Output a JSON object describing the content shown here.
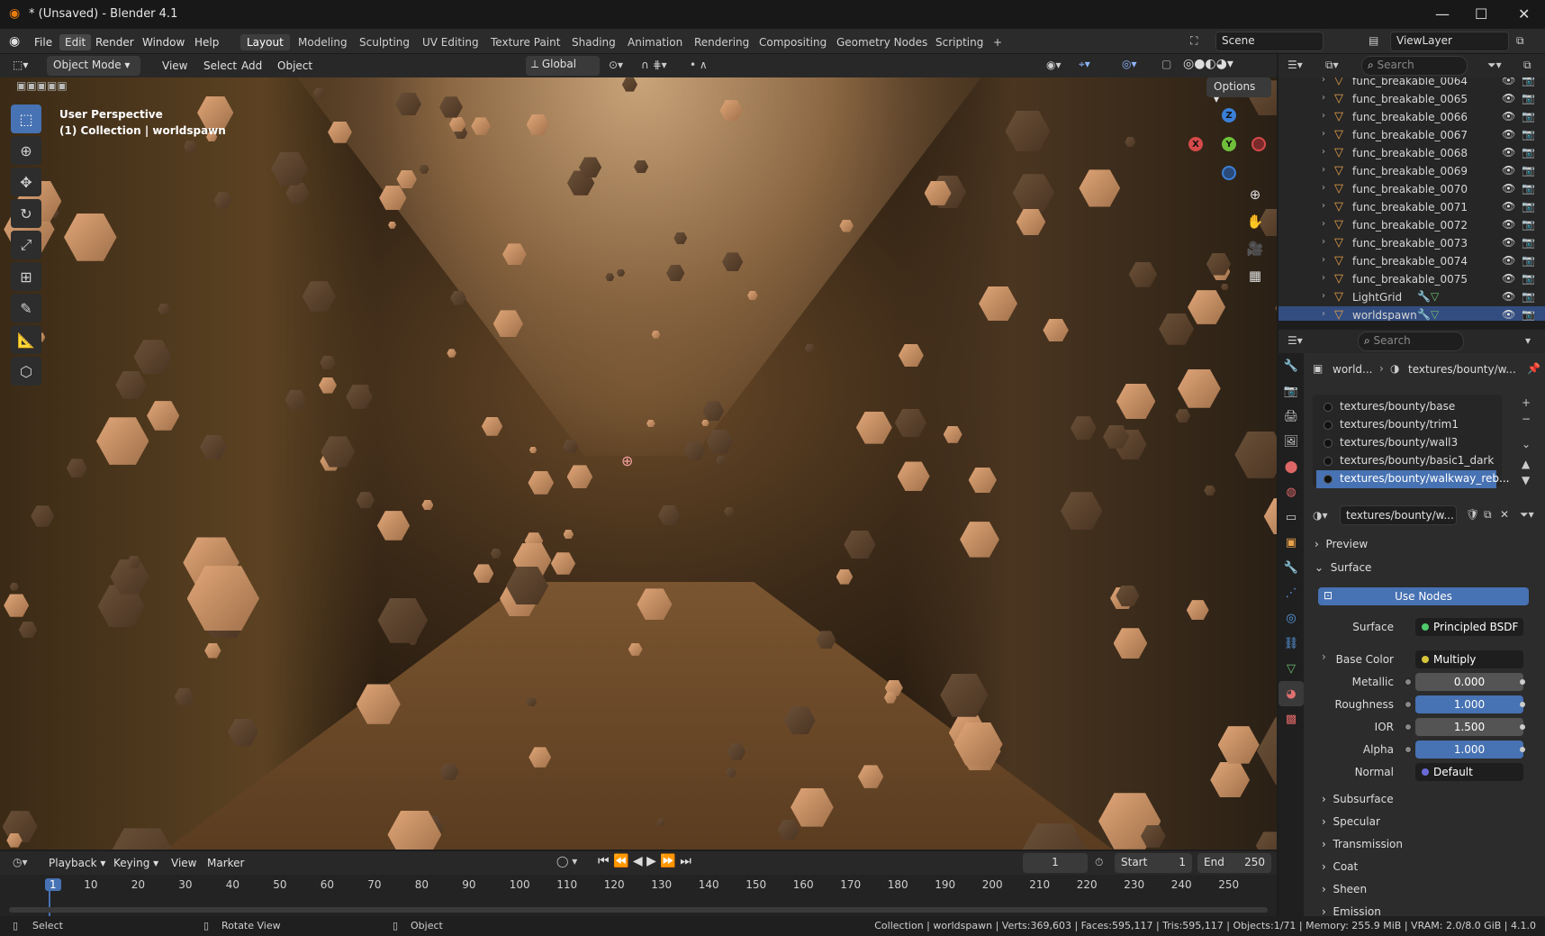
{
  "title_bar": {
    "title": "* (Unsaved) - Blender 4.1",
    "minimize": "—",
    "maximize": "☐",
    "close": "✕"
  },
  "menu": {
    "items": [
      "File",
      "Edit",
      "Render",
      "Window",
      "Help"
    ],
    "highlighted": "Edit"
  },
  "workspaces": {
    "tabs": [
      "Layout",
      "Modeling",
      "Sculpting",
      "UV Editing",
      "Texture Paint",
      "Shading",
      "Animation",
      "Rendering",
      "Compositing",
      "Geometry Nodes",
      "Scripting"
    ],
    "active": "Layout",
    "add": "+"
  },
  "scene": {
    "label": "Scene",
    "view_layer": "ViewLayer"
  },
  "viewport_header": {
    "mode": "Object Mode",
    "menus": [
      "View",
      "Select",
      "Add",
      "Object"
    ],
    "transform": "Global",
    "options": "Options"
  },
  "viewport": {
    "perspective": "User Perspective",
    "collection": "(1) Collection | worldspawn"
  },
  "gizmo": {
    "x": "X",
    "y": "Y",
    "z": "Z"
  },
  "outliner": {
    "search_placeholder": "Search",
    "items": [
      {
        "name": "func_breakable_0064"
      },
      {
        "name": "func_breakable_0065"
      },
      {
        "name": "func_breakable_0066"
      },
      {
        "name": "func_breakable_0067"
      },
      {
        "name": "func_breakable_0068"
      },
      {
        "name": "func_breakable_0069"
      },
      {
        "name": "func_breakable_0070"
      },
      {
        "name": "func_breakable_0071"
      },
      {
        "name": "func_breakable_0072"
      },
      {
        "name": "func_breakable_0073"
      },
      {
        "name": "func_breakable_0074"
      },
      {
        "name": "func_breakable_0075"
      },
      {
        "name": "LightGrid"
      },
      {
        "name": "worldspawn"
      }
    ],
    "selected": "worldspawn"
  },
  "properties": {
    "search_placeholder": "Search",
    "breadcrumb_object": "world...",
    "breadcrumb_material": "textures/bounty/w...",
    "material_slots": [
      "textures/bounty/base",
      "textures/bounty/trim1",
      "textures/bounty/wall3",
      "textures/bounty/basic1_dark",
      "textures/bounty/walkway_reb..."
    ],
    "selected_slot": 4,
    "material_name": "textures/bounty/w...",
    "preview_panel": "Preview",
    "surface_panel": "Surface",
    "use_nodes": "Use Nodes",
    "surface": {
      "surface_label": "Surface",
      "surface_value": "Principled BSDF",
      "base_color_label": "Base Color",
      "base_color_value": "Multiply",
      "metallic_label": "Metallic",
      "metallic_value": "0.000",
      "roughness_label": "Roughness",
      "roughness_value": "1.000",
      "ior_label": "IOR",
      "ior_value": "1.500",
      "alpha_label": "Alpha",
      "alpha_value": "1.000",
      "normal_label": "Normal",
      "normal_value": "Default"
    },
    "subpanels": [
      "Subsurface",
      "Specular",
      "Transmission",
      "Coat",
      "Sheen",
      "Emission"
    ]
  },
  "timeline": {
    "menus": [
      "Playback",
      "Keying",
      "View",
      "Marker"
    ],
    "current_frame": "1",
    "start_label": "Start",
    "start": "1",
    "end_label": "End",
    "end": "250",
    "ticks": [
      "1",
      "10",
      "20",
      "30",
      "40",
      "50",
      "60",
      "70",
      "80",
      "90",
      "100",
      "110",
      "120",
      "130",
      "140",
      "150",
      "160",
      "170",
      "180",
      "190",
      "200",
      "210",
      "220",
      "230",
      "240",
      "250"
    ]
  },
  "status": {
    "select": "Select",
    "rotate": "Rotate View",
    "object": "Object",
    "stats": "Collection | worldspawn | Verts:369,603 | Faces:595,117 | Tris:595,117 | Objects:1/71 | Memory: 255.9 MiB | VRAM: 2.0/8.0 GiB | 4.1.0"
  },
  "colors": {
    "accent": "#4772b3",
    "selected_row": "#334d80",
    "object_orange": "#e8a24a"
  }
}
